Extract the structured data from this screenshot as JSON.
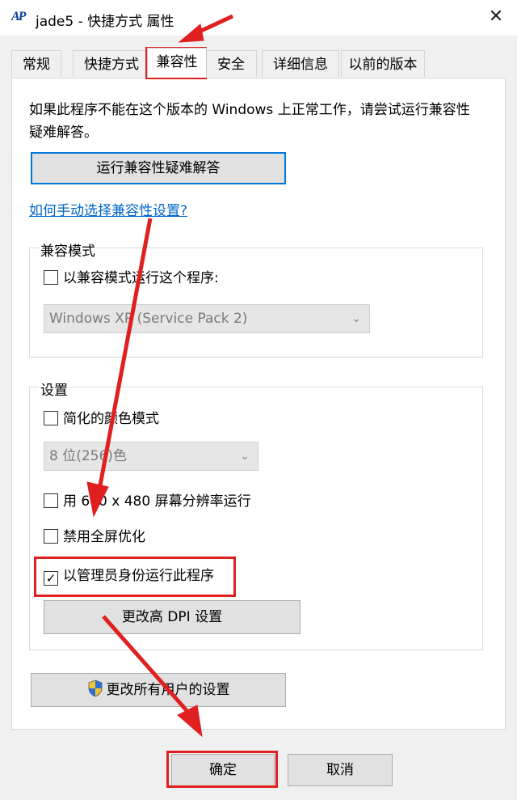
{
  "window": {
    "icon_text": "AP",
    "title": "jade5 - 快捷方式 属性",
    "close_glyph": "✕"
  },
  "tabs": [
    {
      "label": "常规"
    },
    {
      "label": "快捷方式"
    },
    {
      "label": "兼容性",
      "active": true
    },
    {
      "label": "安全"
    },
    {
      "label": "详细信息"
    },
    {
      "label": "以前的版本"
    }
  ],
  "compat": {
    "description": "如果此程序不能在这个版本的 Windows 上正常工作，请尝试运行兼容性疑难解答。",
    "troubleshoot_button": "运行兼容性疑难解答",
    "manual_link": "如何手动选择兼容性设置?"
  },
  "compat_mode": {
    "group_label": "兼容模式",
    "checkbox_label": "以兼容模式运行这个程序:",
    "checked": false,
    "os_select": "Windows XP (Service Pack 2)"
  },
  "settings": {
    "group_label": "设置",
    "reduced_color": {
      "label": "简化的颜色模式",
      "checked": false
    },
    "color_select": "8 位(256)色",
    "res_640": {
      "label": "用 640 x 480 屏幕分辨率运行",
      "checked": false
    },
    "disable_fullscreen": {
      "label": "禁用全屏优化",
      "checked": false
    },
    "run_as_admin": {
      "label": "以管理员身份运行此程序",
      "checked": true,
      "check_glyph": "✓"
    },
    "dpi_button": "更改高 DPI 设置"
  },
  "all_users_button": "更改所有用户的设置",
  "footer": {
    "ok": "确定",
    "cancel": "取消"
  },
  "colors": {
    "annotation_red": "#e02020",
    "link_blue": "#0066cc",
    "focus_blue": "#0078d7"
  }
}
